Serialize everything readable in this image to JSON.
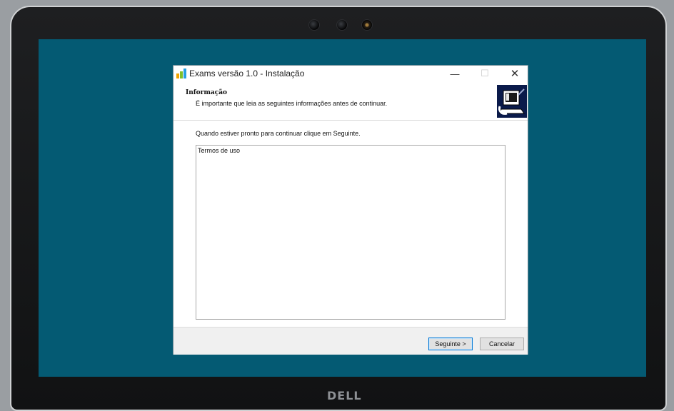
{
  "device": {
    "brand": "DELL"
  },
  "window": {
    "title": "Exams versão 1.0 - Instalação",
    "minimize_glyph": "—",
    "maximize_glyph": "☐",
    "close_glyph": "✕"
  },
  "header": {
    "heading": "Informação",
    "subtitle": "É importante que leia as seguintes informações antes de continuar."
  },
  "body": {
    "ready_text": "Quando estiver pronto para continuar clique em Seguinte.",
    "memo_text": "Termos de uso"
  },
  "buttons": {
    "next_label": "Seguinte >",
    "cancel_label": "Cancelar"
  },
  "colors": {
    "desktop": "#045a73",
    "accent": "#0078d7"
  }
}
